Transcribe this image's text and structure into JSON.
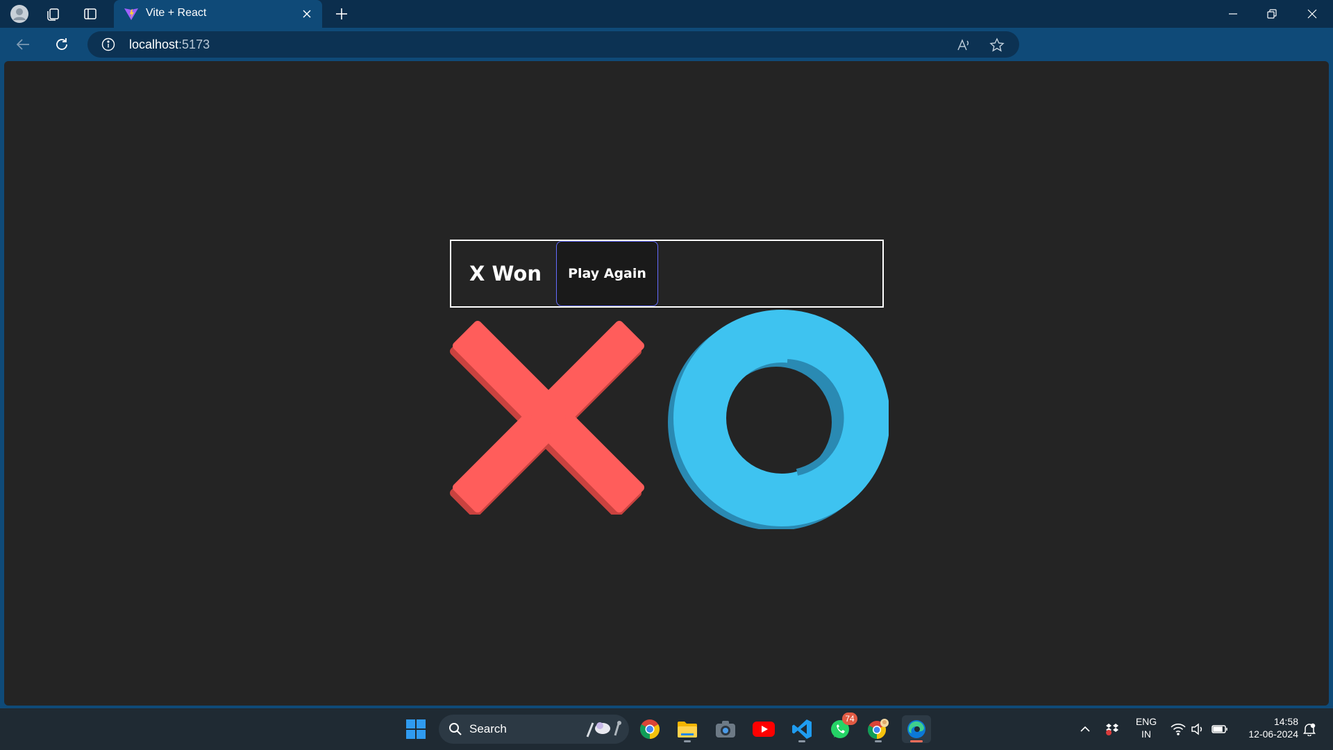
{
  "browser": {
    "tab": {
      "title": "Vite + React",
      "favicon": "vite-logo-icon"
    },
    "address": {
      "host": "localhost",
      "port": ":5173"
    },
    "icons": [
      "profile-icon",
      "workspaces-icon",
      "tab-actions-icon",
      "close-icon",
      "new-tab-icon",
      "back-icon",
      "refresh-icon",
      "site-info-icon",
      "read-aloud-icon",
      "favorite-star-icon",
      "browser-essentials-icon",
      "extensions-icon",
      "split-screen-icon",
      "favorites-icon",
      "collections-icon",
      "performance-icon",
      "more-icon",
      "copilot-icon",
      "minimize-icon",
      "restore-icon",
      "window-close-icon"
    ]
  },
  "game": {
    "status": "X Won",
    "play_again_label": "Play Again",
    "colors": {
      "x": "#ff5d5b",
      "x_shadow": "#c9423f",
      "o": "#3ec3f0",
      "o_shadow": "#2a8ab3",
      "accent_border": "#646cff",
      "background": "#242424"
    }
  },
  "taskbar": {
    "search": {
      "label": "Search"
    },
    "apps": [
      "windows-start-icon",
      "chrome-icon",
      "file-explorer-icon",
      "camera-icon",
      "youtube-icon",
      "vscode-icon",
      "whatsapp-icon",
      "chrome-profile-icon",
      "edge-icon"
    ],
    "whatsapp_badge": "74",
    "tray": {
      "language_top": "ENG",
      "language_bottom": "IN",
      "time": "14:58",
      "date": "12-06-2024"
    }
  }
}
